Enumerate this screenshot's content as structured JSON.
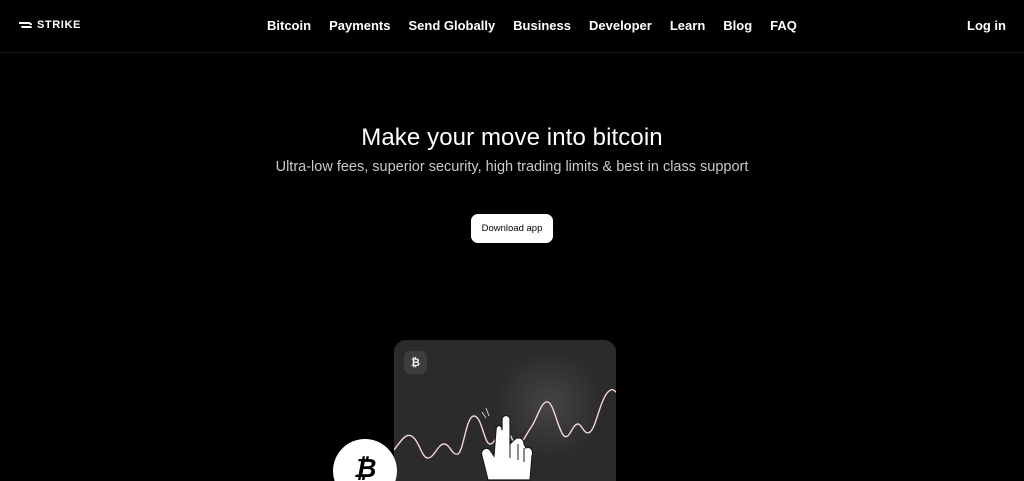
{
  "header": {
    "brand": "STRIKE",
    "nav": [
      {
        "label": "Bitcoin"
      },
      {
        "label": "Payments"
      },
      {
        "label": "Send Globally"
      },
      {
        "label": "Business"
      },
      {
        "label": "Developer"
      },
      {
        "label": "Learn"
      },
      {
        "label": "Blog"
      },
      {
        "label": "FAQ"
      }
    ],
    "login_label": "Log in"
  },
  "hero": {
    "title": "Make your move into bitcoin",
    "subtitle": "Ultra-low fees, superior security, high trading limits & best in class support",
    "cta_label": "Download app"
  },
  "illustration": {
    "coin_symbol": "₿",
    "big_coin_symbol": "₿",
    "icons": [
      "strike-logo-icon",
      "bitcoin-icon",
      "hand-pointer-icon"
    ],
    "line_color": "#f3d4d4",
    "card_color": "#2b2b2b"
  }
}
